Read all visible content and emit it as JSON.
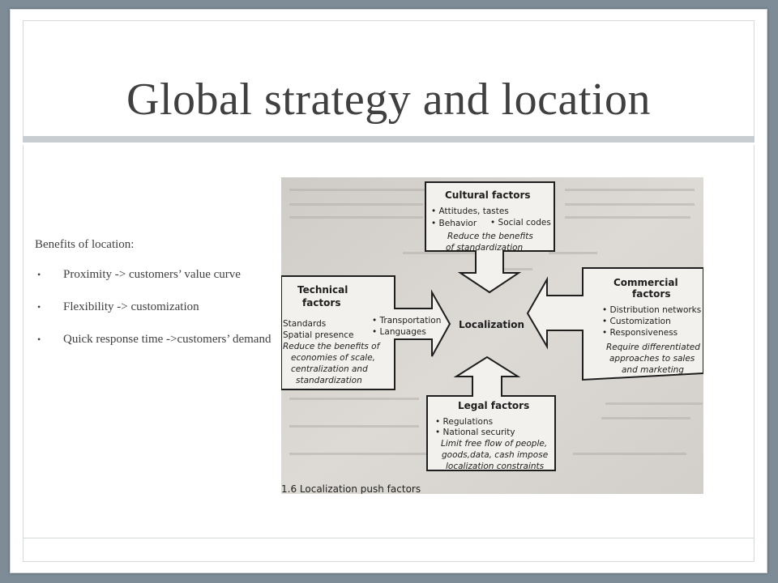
{
  "slide": {
    "title": "Global strategy and location",
    "intro": "Benefits of location:",
    "bullets": [
      "Proximity -> customers’ value curve",
      "Flexibility -> customization",
      "Quick response time ->customers’ demand"
    ]
  },
  "diagram": {
    "center": "Localization",
    "cultural": {
      "title": "Cultural factors",
      "items": [
        "• Attitudes, tastes",
        "• Behavior",
        "• Social codes"
      ],
      "note": [
        "Reduce the benefits",
        "of standardization"
      ]
    },
    "technical": {
      "title": [
        "Technical",
        "factors"
      ],
      "plain": [
        "Standards",
        "Spatial presence"
      ],
      "items": [
        "• Transportation",
        "• Languages"
      ],
      "note": [
        "Reduce the benefits of",
        "economies of scale,",
        "centralization and",
        "standardization"
      ]
    },
    "commercial": {
      "title": [
        "Commercial",
        "factors"
      ],
      "items": [
        "• Distribution networks",
        "• Customization",
        "• Responsiveness"
      ],
      "note": [
        "Require differentiated",
        "approaches to sales",
        "and marketing"
      ]
    },
    "legal": {
      "title": "Legal factors",
      "items": [
        "• Regulations",
        "• National security"
      ],
      "note": [
        "Limit free flow of people,",
        "goods,data, cash impose",
        "localization constraints"
      ]
    },
    "caption": "1.6  Localization push factors"
  },
  "colors": {
    "background": "#7d8c96",
    "title_text": "#404040",
    "photo_paper": "#d6d3ce"
  }
}
